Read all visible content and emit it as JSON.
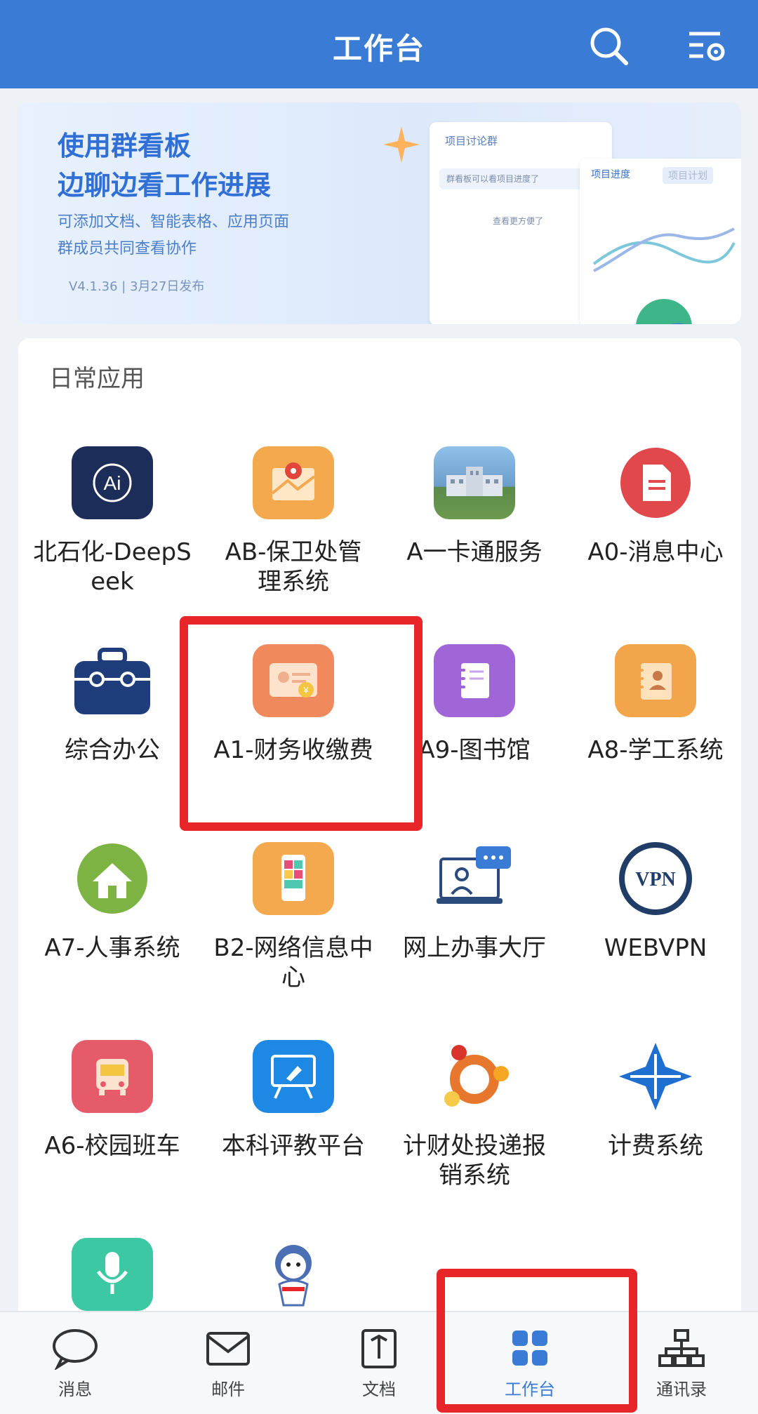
{
  "header": {
    "title": "工作台",
    "search_icon": "search-icon",
    "settings_icon": "list-settings-icon"
  },
  "banner": {
    "headline_1": "使用群看板",
    "headline_2": "边聊边看工作进展",
    "sub_1": "可添加文档、智能表格、应用页面",
    "sub_2": "群成员共同查看协作",
    "version": "V4.1.36 | 3月27日发布",
    "mock_group_title": "项目讨论群",
    "mock_bubble_1": "群看板可以看项目进度了",
    "mock_bubble_2": "查看更方便了",
    "mock_tab_1": "项目进度",
    "mock_tab_2": "项目计划"
  },
  "daily_apps": {
    "section_title": "日常应用",
    "apps": [
      {
        "label": "北石化-DeepSeek",
        "icon": "ai-icon",
        "color": "#1d2d5a"
      },
      {
        "label": "AB-保卫处管理系统",
        "icon": "map-pin-icon",
        "color": "#f5a94e"
      },
      {
        "label": "A一卡通服务",
        "icon": "campus-building-icon",
        "color": "#6d9cc9"
      },
      {
        "label": "A0-消息中心",
        "icon": "document-icon",
        "color": "#e0484b"
      },
      {
        "label": "综合办公",
        "icon": "briefcase-icon",
        "color": "#1f3d7a"
      },
      {
        "label": "A1-财务收缴费",
        "icon": "payment-card-icon",
        "color": "#f08a5d"
      },
      {
        "label": "A9-图书馆",
        "icon": "notebook-icon",
        "color": "#a066d8"
      },
      {
        "label": "A8-学工系统",
        "icon": "contact-book-icon",
        "color": "#f2a54a"
      },
      {
        "label": "A7-人事系统",
        "icon": "home-icon",
        "color": "#7cb342"
      },
      {
        "label": "B2-网络信息中心",
        "icon": "phone-icon",
        "color": "#f5a94e"
      },
      {
        "label": "网上办事大厅",
        "icon": "online-hall-icon",
        "color": "#3a7bd5"
      },
      {
        "label": "WEBVPN",
        "icon": "vpn-icon",
        "color": "#1f3d66"
      },
      {
        "label": "A6-校园班车",
        "icon": "bus-icon",
        "color": "#e65b6a"
      },
      {
        "label": "本科评教平台",
        "icon": "whiteboard-icon",
        "color": "#1e88e5"
      },
      {
        "label": "计财处投递报销系统",
        "icon": "ubuntu-logo-icon",
        "color": "#e8772e"
      },
      {
        "label": "计费系统",
        "icon": "cross-logo-icon",
        "color": "#1e6fd0"
      },
      {
        "label": "",
        "icon": "microphone-icon",
        "color": "#3cc8a3"
      },
      {
        "label": "",
        "icon": "mascot-icon",
        "color": "#ffffff"
      }
    ]
  },
  "bottom_nav": {
    "items": [
      {
        "label": "消息",
        "icon": "chat-bubble-icon"
      },
      {
        "label": "邮件",
        "icon": "mail-icon"
      },
      {
        "label": "文档",
        "icon": "doc-icon"
      },
      {
        "label": "工作台",
        "icon": "grid-icon"
      },
      {
        "label": "通讯录",
        "icon": "org-chart-icon"
      }
    ],
    "active_index": 3
  }
}
